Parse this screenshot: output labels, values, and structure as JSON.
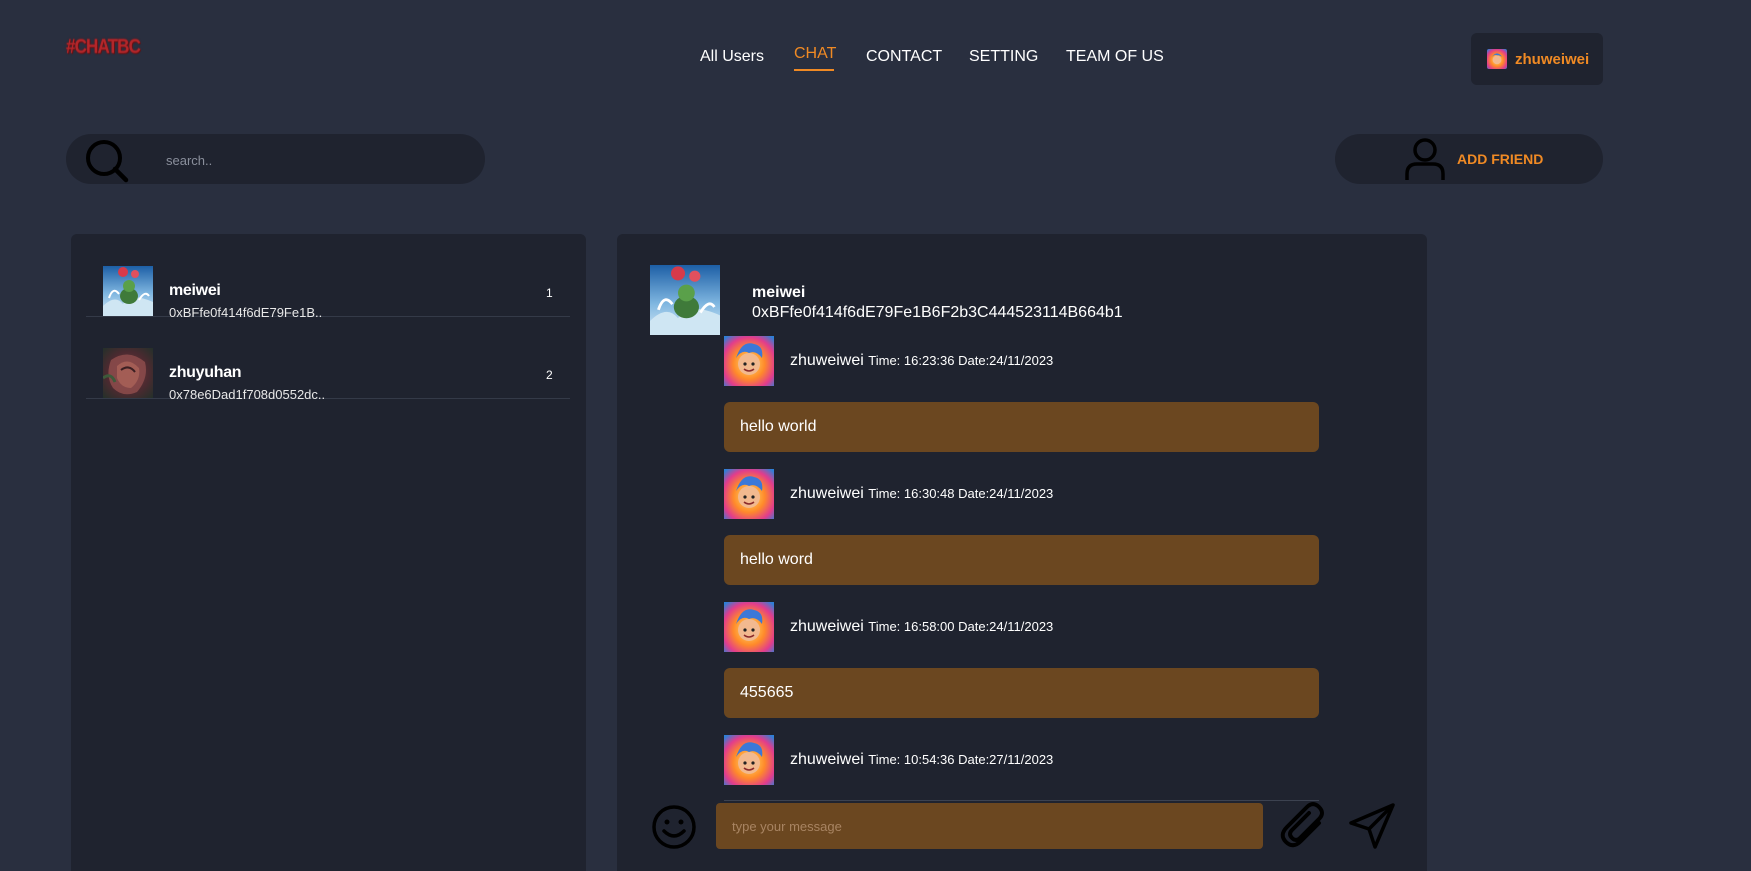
{
  "brand": {
    "logo_text": "#CHATBC"
  },
  "nav": {
    "items": [
      {
        "label": "All Users"
      },
      {
        "label": "CHAT"
      },
      {
        "label": "CONTACT"
      },
      {
        "label": "SETTING"
      },
      {
        "label": "TEAM OF US"
      }
    ],
    "active": "CHAT"
  },
  "current_user": {
    "name": "zhuweiwei"
  },
  "search": {
    "placeholder": "search..",
    "value": ""
  },
  "add_friend": {
    "label": "ADD FRIEND"
  },
  "friends": [
    {
      "name": "meiwei",
      "address": "0xBFfe0f414f6dE79Fe1B..",
      "index": "1"
    },
    {
      "name": "zhuyuhan",
      "address": "0x78e6Dad1f708d0552dc..",
      "index": "2"
    }
  ],
  "chat": {
    "name": "meiwei",
    "address": "0xBFfe0f414f6dE79Fe1B6F2b3C444523114B664b1",
    "messages": [
      {
        "sender": "zhuweiwei",
        "time": "Time: 16:23:36 Date:24/11/2023",
        "text": "hello world"
      },
      {
        "sender": "zhuweiwei",
        "time": "Time: 16:30:48 Date:24/11/2023",
        "text": "hello word"
      },
      {
        "sender": "zhuweiwei",
        "time": "Time: 16:58:00 Date:24/11/2023",
        "text": "455665"
      },
      {
        "sender": "zhuweiwei",
        "time": "Time: 10:54:36 Date:27/11/2023",
        "text": ""
      }
    ],
    "compose_placeholder": "type your message",
    "compose_value": ""
  },
  "colors": {
    "background": "#292f3f",
    "panel": "#1f232f",
    "accent": "#f08a24",
    "bubble": "#6b4720",
    "logo": "#b3262a"
  },
  "icons": {
    "search": "search-icon",
    "add_friend": "person-icon",
    "emoji": "smiley-icon",
    "attach": "paperclip-icon",
    "send": "paper-plane-icon"
  }
}
